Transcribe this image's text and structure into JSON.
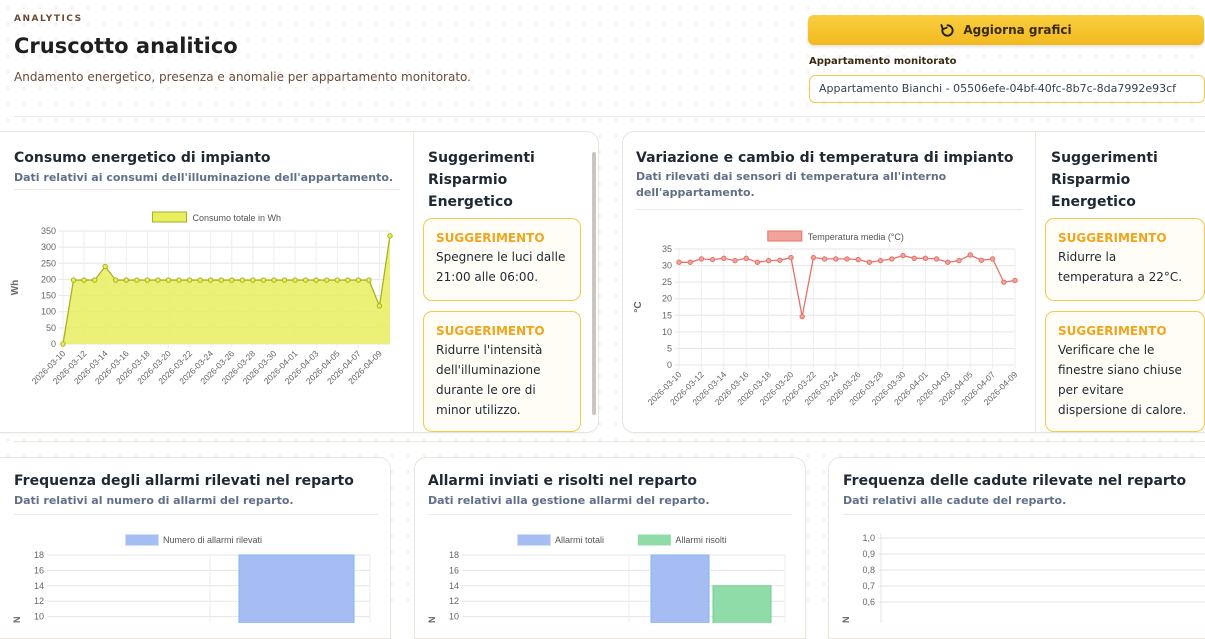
{
  "header": {
    "eyebrow": "ANALYTICS",
    "title": "Cruscotto analitico",
    "subtitle": "Andamento energetico, presenza e anomalie per appartamento monitorato."
  },
  "controls": {
    "refresh_label": "Aggiorna grafici",
    "refresh_icon": "refresh-icon",
    "apartment_label": "Appartamento monitorato",
    "apartment_value": "Appartamento Bianchi - 05506efe-04bf-40fc-8b7c-8da7992e93cf"
  },
  "energy_card": {
    "title": "Consumo energetico di impianto",
    "subtitle": "Dati relativi ai consumi dell'illuminazione dell'appartamento.",
    "tips_title_1": "Suggerimenti",
    "tips_title_2": "Risparmio",
    "tips_title_3": "Energetico",
    "tips": [
      {
        "tag": "SUGGERIMENTO",
        "text": "Spegnere le luci dalle 21:00 alle 06:00."
      },
      {
        "tag": "SUGGERIMENTO",
        "text": "Ridurre l'intensità dell'illuminazione durante le ore di minor utilizzo."
      }
    ]
  },
  "temp_card": {
    "title": "Variazione e cambio di temperatura di impianto",
    "subtitle": "Dati rilevati dai sensori di temperatura all'interno dell'appartamento.",
    "tips_title_1": "Suggerimenti",
    "tips_title_2": "Risparmio",
    "tips_title_3": "Energetico",
    "tips": [
      {
        "tag": "SUGGERIMENTO",
        "text": "Ridurre la temperatura a 22°C."
      },
      {
        "tag": "SUGGERIMENTO",
        "text": "Verificare che le finestre siano chiuse per evitare dispersione di calore."
      }
    ]
  },
  "alarms_card": {
    "title": "Frequenza degli allarmi rilevati nel reparto",
    "subtitle": "Dati relativi al numero di allarmi del reparto."
  },
  "alarms_sent_card": {
    "title": "Allarmi inviati e risolti nel reparto",
    "subtitle": "Dati relativi alla gestione allarmi del reparto."
  },
  "falls_card": {
    "title": "Frequenza delle cadute rilevate nel reparto",
    "subtitle": "Dati relativi alle cadute del reparto."
  },
  "chart_data": [
    {
      "id": "energy",
      "type": "area",
      "legend": "Consumo totale in Wh",
      "ylabel": "Wh",
      "ylim": [
        0,
        350
      ],
      "yticks": [
        0,
        50,
        100,
        150,
        200,
        250,
        300,
        350
      ],
      "x_tick_labels": [
        "2026-03-10",
        "2026-03-12",
        "2026-03-14",
        "2026-03-16",
        "2026-03-18",
        "2026-03-20",
        "2026-03-22",
        "2026-03-24",
        "2026-03-26",
        "2026-03-28",
        "2026-03-30",
        "2026-04-01",
        "2026-04-03",
        "2026-04-05",
        "2026-04-07",
        "2026-04-09"
      ],
      "values": [
        0,
        198,
        198,
        198,
        240,
        198,
        198,
        198,
        198,
        198,
        198,
        198,
        198,
        198,
        198,
        198,
        198,
        198,
        198,
        198,
        198,
        198,
        198,
        198,
        198,
        198,
        198,
        198,
        198,
        198,
        118,
        335
      ],
      "color": "#e8ee5f",
      "line_color": "#aab21c"
    },
    {
      "id": "temperature",
      "type": "line",
      "legend": "Temperatura media (°C)",
      "ylabel": "°C",
      "ylim": [
        0,
        35
      ],
      "yticks": [
        0,
        5,
        10,
        15,
        20,
        25,
        30,
        35
      ],
      "x_tick_labels": [
        "2026-03-10",
        "2026-03-12",
        "2026-03-14",
        "2026-03-16",
        "2026-03-18",
        "2026-03-20",
        "2026-03-22",
        "2026-03-24",
        "2026-03-26",
        "2026-03-28",
        "2026-03-30",
        "2026-04-01",
        "2026-04-03",
        "2026-04-05",
        "2026-04-07",
        "2026-04-09"
      ],
      "values": [
        31,
        31,
        32,
        31.8,
        32.2,
        31.5,
        32.2,
        31,
        31.5,
        31.6,
        32.4,
        14.6,
        32.4,
        32,
        32,
        32,
        31.8,
        31,
        31.5,
        32,
        33,
        32.2,
        32.2,
        32,
        31,
        31.5,
        33.2,
        31.6,
        32,
        25,
        25.5
      ],
      "color": "#f0a39b",
      "line_color": "#e57368"
    },
    {
      "id": "alarms",
      "type": "bar",
      "legend": "Numero di allarmi rilevati",
      "ylim": [
        0,
        18
      ],
      "yticks": [
        10,
        12,
        14,
        16,
        18
      ],
      "values": [
        18
      ],
      "color": "#a5bdf2",
      "border": "#7fb6ec"
    },
    {
      "id": "alarms_sent",
      "type": "bar",
      "series": [
        {
          "name": "Allarmi totali",
          "values": [
            18
          ],
          "color": "#a5bdf2"
        },
        {
          "name": "Allarmi risolti",
          "values": [
            14
          ],
          "color": "#8fdca8"
        }
      ],
      "ylim": [
        0,
        18
      ],
      "yticks": [
        10,
        12,
        14,
        16,
        18
      ]
    },
    {
      "id": "falls",
      "type": "line",
      "ylim": [
        0,
        1
      ],
      "yticks": [
        "0,6",
        "0,7",
        "0,8",
        "0,9",
        "1,0"
      ]
    }
  ]
}
